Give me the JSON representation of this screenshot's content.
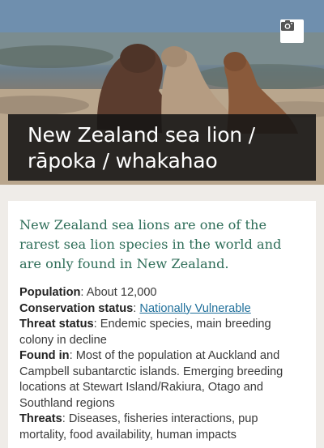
{
  "hero": {
    "title_line1": "New Zealand sea lion /",
    "title_line2": "rāpoka / whakahao",
    "camera_icon": "camera-icon"
  },
  "intro": "New Zealand sea lions are one of the rarest sea lion species in the world and are only found in New Zealand.",
  "facts": {
    "population": {
      "label": "Population",
      "sep": ": ",
      "value": "About 12,000"
    },
    "conservation": {
      "label": "Conservation status",
      "sep": ": ",
      "link": "Nationally Vulnerable"
    },
    "threat_status": {
      "label": "Threat status",
      "sep": ": ",
      "value": "Endemic species, main breeding colony in decline"
    },
    "found_in": {
      "label": "Found in",
      "sep": ": ",
      "value": "Most of the population at Auckland and Campbell subantarctic islands. Emerging breeding locations at Stewart Island/Rakiura, Otago and Southland regions"
    },
    "threats": {
      "label": "Threats",
      "sep": ": ",
      "value": "Diseases, fisheries interactions, pup mortality, food availability, human impacts"
    }
  }
}
